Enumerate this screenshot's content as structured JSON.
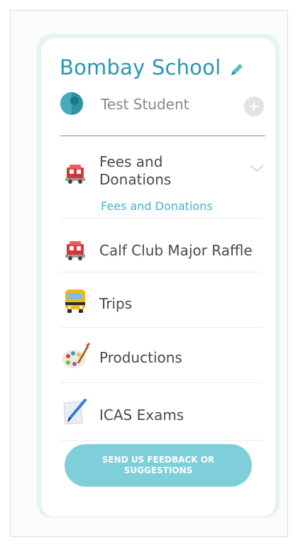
{
  "header": {
    "school_name": "Bombay School",
    "student_name": "Test Student"
  },
  "menu": {
    "fees": {
      "label": "Fees and Donations",
      "sub_label": "Fees and Donations"
    },
    "items": [
      {
        "label": "Calf Club Major Raffle",
        "icon": "fire-truck-icon"
      },
      {
        "label": "Trips",
        "icon": "school-bus-icon"
      },
      {
        "label": "Productions",
        "icon": "palette-icon"
      },
      {
        "label": "ICAS Exams",
        "icon": "quill-paper-icon"
      }
    ]
  },
  "feedback_button": {
    "label": "SEND US FEEDBACK OR SUGGESTIONS"
  },
  "colors": {
    "brand": "#2a97b2",
    "button": "#7fcfdb",
    "sublink": "#4bb0c8"
  }
}
